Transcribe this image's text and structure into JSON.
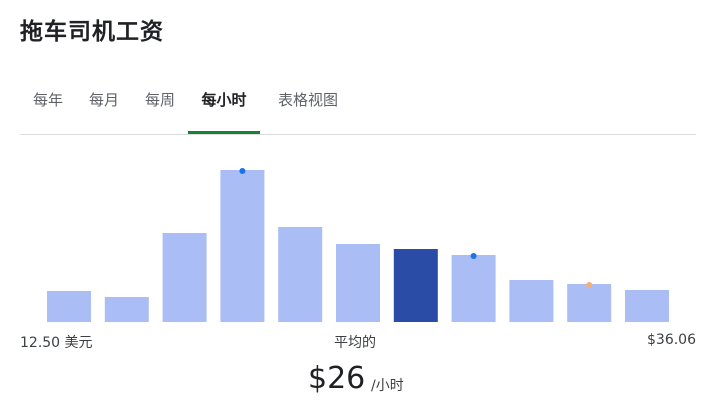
{
  "title": "拖车司机工资",
  "tabs": [
    {
      "label": "每年",
      "active": false
    },
    {
      "label": "每月",
      "active": false
    },
    {
      "label": "每周",
      "active": false
    },
    {
      "label": "每小时",
      "active": true
    },
    {
      "label": "表格视图",
      "active": false
    }
  ],
  "colors": {
    "bar": "#aabdf4",
    "bar_highlight": "#2a4ba6",
    "tab_underline": "#188038",
    "dot_blue": "#1a73e8",
    "dot_orange": "#f6ae73"
  },
  "chart_data": {
    "type": "bar",
    "categories": [
      "1",
      "2",
      "3",
      "4",
      "5",
      "6",
      "7",
      "8",
      "9",
      "10",
      "11"
    ],
    "values": [
      31,
      25,
      89,
      152,
      95,
      78,
      73,
      67,
      42,
      38,
      32
    ],
    "highlight_index": 6,
    "markers": [
      {
        "index": 3,
        "color": "blue"
      },
      {
        "index": 7,
        "color": "blue"
      },
      {
        "index": 9,
        "color": "orange"
      }
    ],
    "min_label": "12.50 美元",
    "mid_label": "平均的",
    "max_label": "$36.06"
  },
  "summary": {
    "value": "$26",
    "unit": "/小时"
  }
}
